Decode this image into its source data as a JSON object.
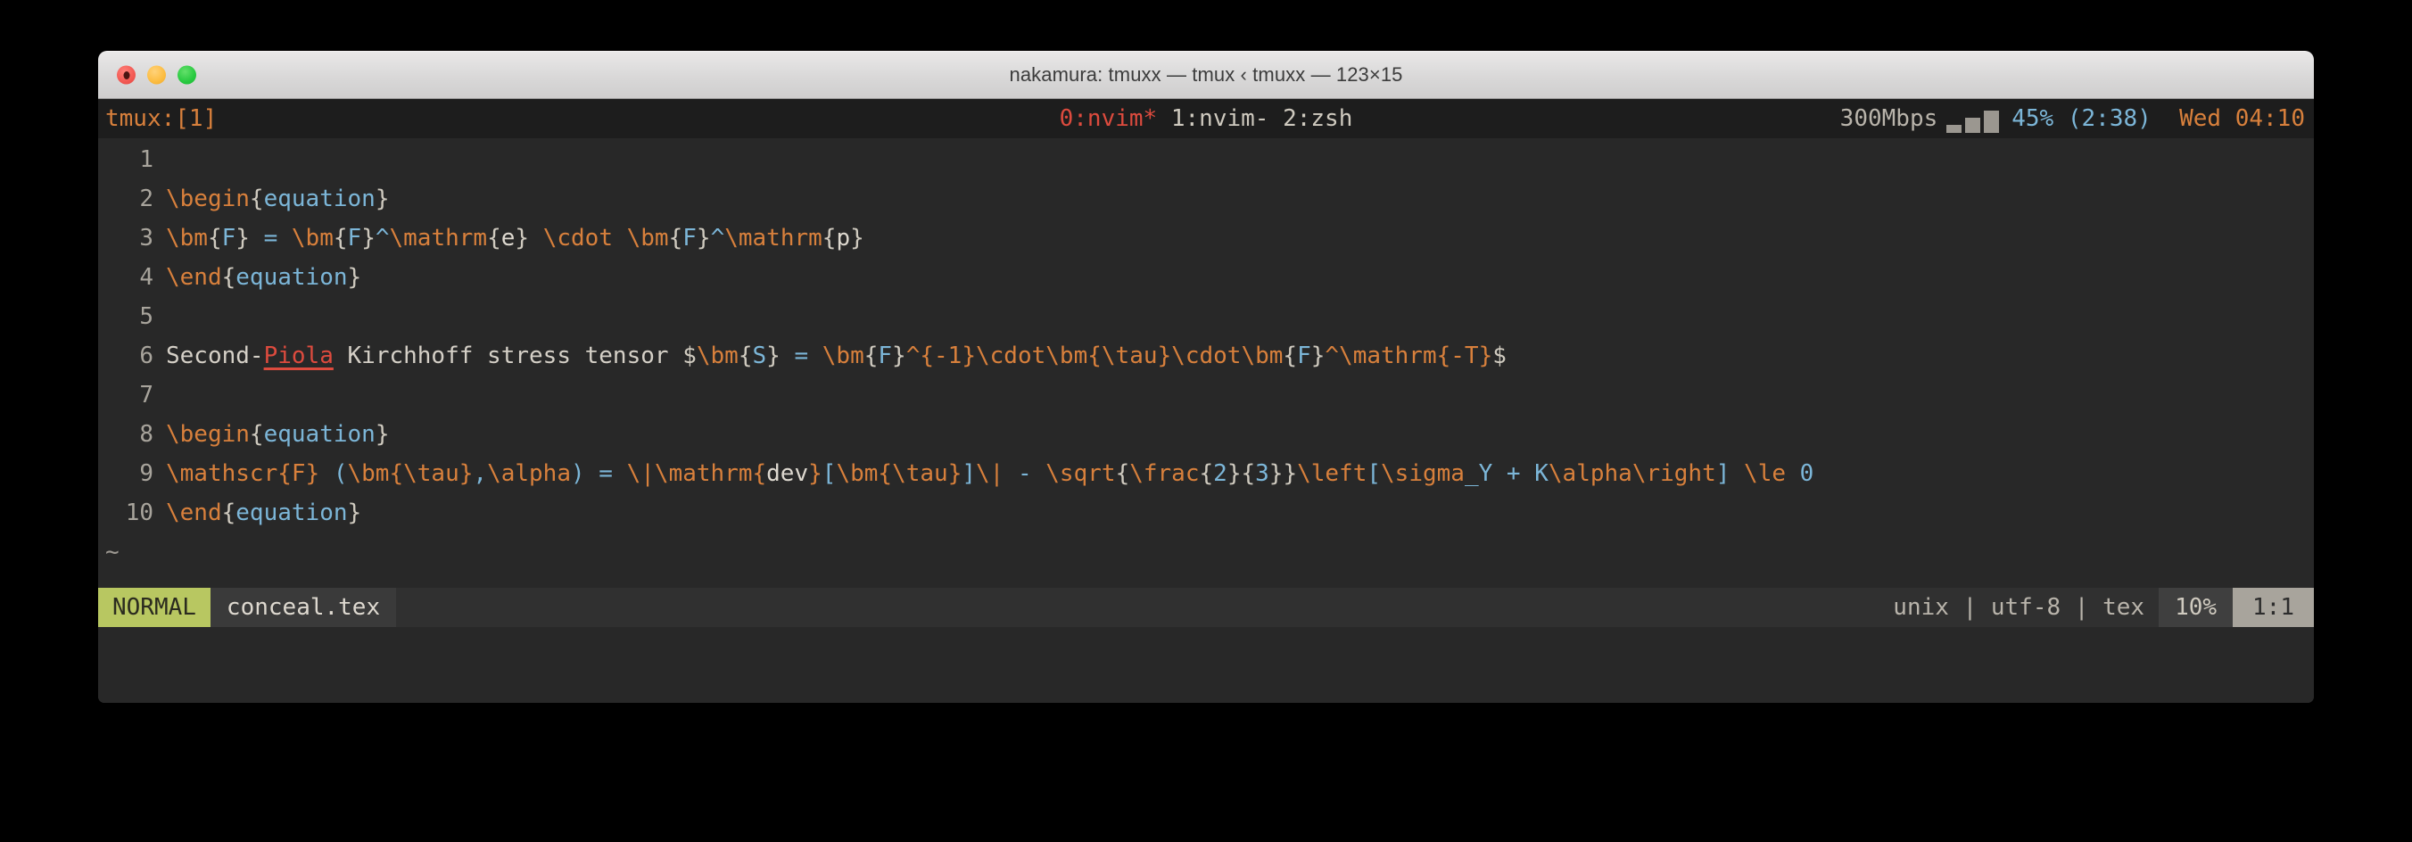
{
  "window": {
    "title": "nakamura: tmuxx — tmux ‹ tmuxx — 123×15",
    "controls": {
      "close": "close",
      "minimize": "minimize",
      "maximize": "maximize"
    }
  },
  "tmux": {
    "session_label": "tmux:[1]",
    "windows": [
      {
        "label": "0:nvim*",
        "active": true
      },
      {
        "label": "1:nvim-",
        "active": false
      },
      {
        "label": "2:zsh",
        "active": false
      }
    ],
    "windows_line": "0:nvim* 1:nvim- 2:zsh",
    "network": "300Mbps",
    "signal_bars": 3,
    "battery": "45% (2:38)",
    "clock": "Wed 04:10",
    "colors": {
      "session": "#d8803c",
      "active_window": "#dd4b3e",
      "inactive_window": "#cfcabf",
      "battery": "#7cb6d8",
      "clock": "#d8803c",
      "background": "#1d1d1d"
    }
  },
  "editor": {
    "background": "#282828",
    "filetype": "tex",
    "lines": [
      {
        "number": "1",
        "text": ""
      },
      {
        "number": "2",
        "text": "\\begin{equation}"
      },
      {
        "number": "3",
        "text": "\\bm{F} = \\bm{F}^\\mathrm{e} \\cdot \\bm{F}^\\mathrm{p}"
      },
      {
        "number": "4",
        "text": "\\end{equation}"
      },
      {
        "number": "5",
        "text": ""
      },
      {
        "number": "6",
        "text": "Second-Piola Kirchhoff stress tensor $\\bm{S} = \\bm{F}^{-1}\\cdot\\bm{\\tau}\\cdot\\bm{F}^\\mathrm{-T}$"
      },
      {
        "number": "7",
        "text": ""
      },
      {
        "number": "8",
        "text": "\\begin{equation}"
      },
      {
        "number": "9",
        "text": "\\mathscr{F} (\\bm{\\tau},\\alpha) = \\|\\mathrm{dev}[\\bm{\\tau}]\\| - \\sqrt{\\frac{2}{3}}\\left[\\sigma_Y + K\\alpha\\right] \\le 0"
      },
      {
        "number": "10",
        "text": "\\end{equation}"
      }
    ],
    "empty_markers": [
      "~",
      "~"
    ],
    "misspelled_word": "Piola",
    "syntax_colors": {
      "command": "#d8803c",
      "brace": "#cfcabf",
      "argument": "#7cb6d8",
      "text": "#d5d0c7",
      "spell_error": "#dd4b3e"
    }
  },
  "statusline": {
    "mode": "NORMAL",
    "filename": "conceal.tex",
    "fileformat": "unix",
    "encoding": "utf-8",
    "filetype": "tex",
    "info": "unix | utf-8 | tex",
    "percent": "10%",
    "position": "1:1",
    "mode_color": "#b8c761"
  }
}
